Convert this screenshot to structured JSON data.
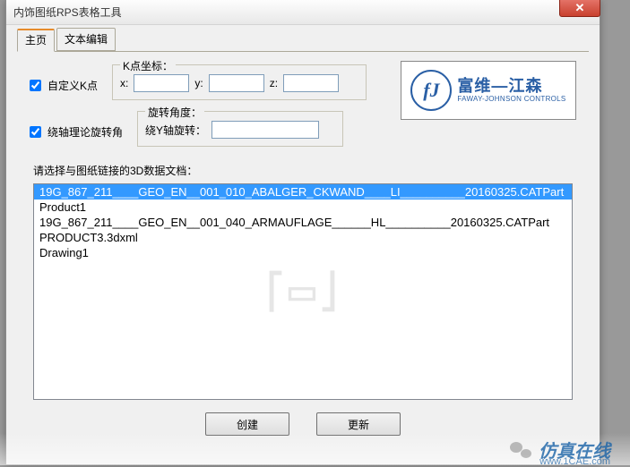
{
  "title": "内饰图纸RPS表格工具",
  "tabs": [
    "主页",
    "文本编辑"
  ],
  "checkbox_k": "自定义K点",
  "k_fieldset": {
    "legend": "K点坐标：",
    "x_label": "x:",
    "y_label": "y:",
    "z_label": "z:",
    "x_val": "",
    "y_val": "",
    "z_val": ""
  },
  "checkbox_rot": "绕轴理论旋转角",
  "rot_fieldset": {
    "legend": "旋转角度：",
    "label": "绕Y轴旋转：",
    "val": ""
  },
  "logo": {
    "cn": "富维—江森",
    "en": "FAWAY-JOHNSON CONTROLS"
  },
  "list_label": "请选择与图纸链接的3D数据文档：",
  "list_items": [
    "19G_867_211____GEO_EN__001_010_ABALGER_CKWAND____LI__________20160325.CATPart",
    "Product1",
    "19G_867_211____GEO_EN__001_040_ARMAUFLAGE______HL__________20160325.CATPart",
    "PRODUCT3.3dxml",
    "Drawing1"
  ],
  "selected_index": 0,
  "buttons": {
    "create": "创建",
    "update": "更新"
  },
  "footer": {
    "brand": "仿真在线",
    "url": "www.1CAE.com"
  }
}
